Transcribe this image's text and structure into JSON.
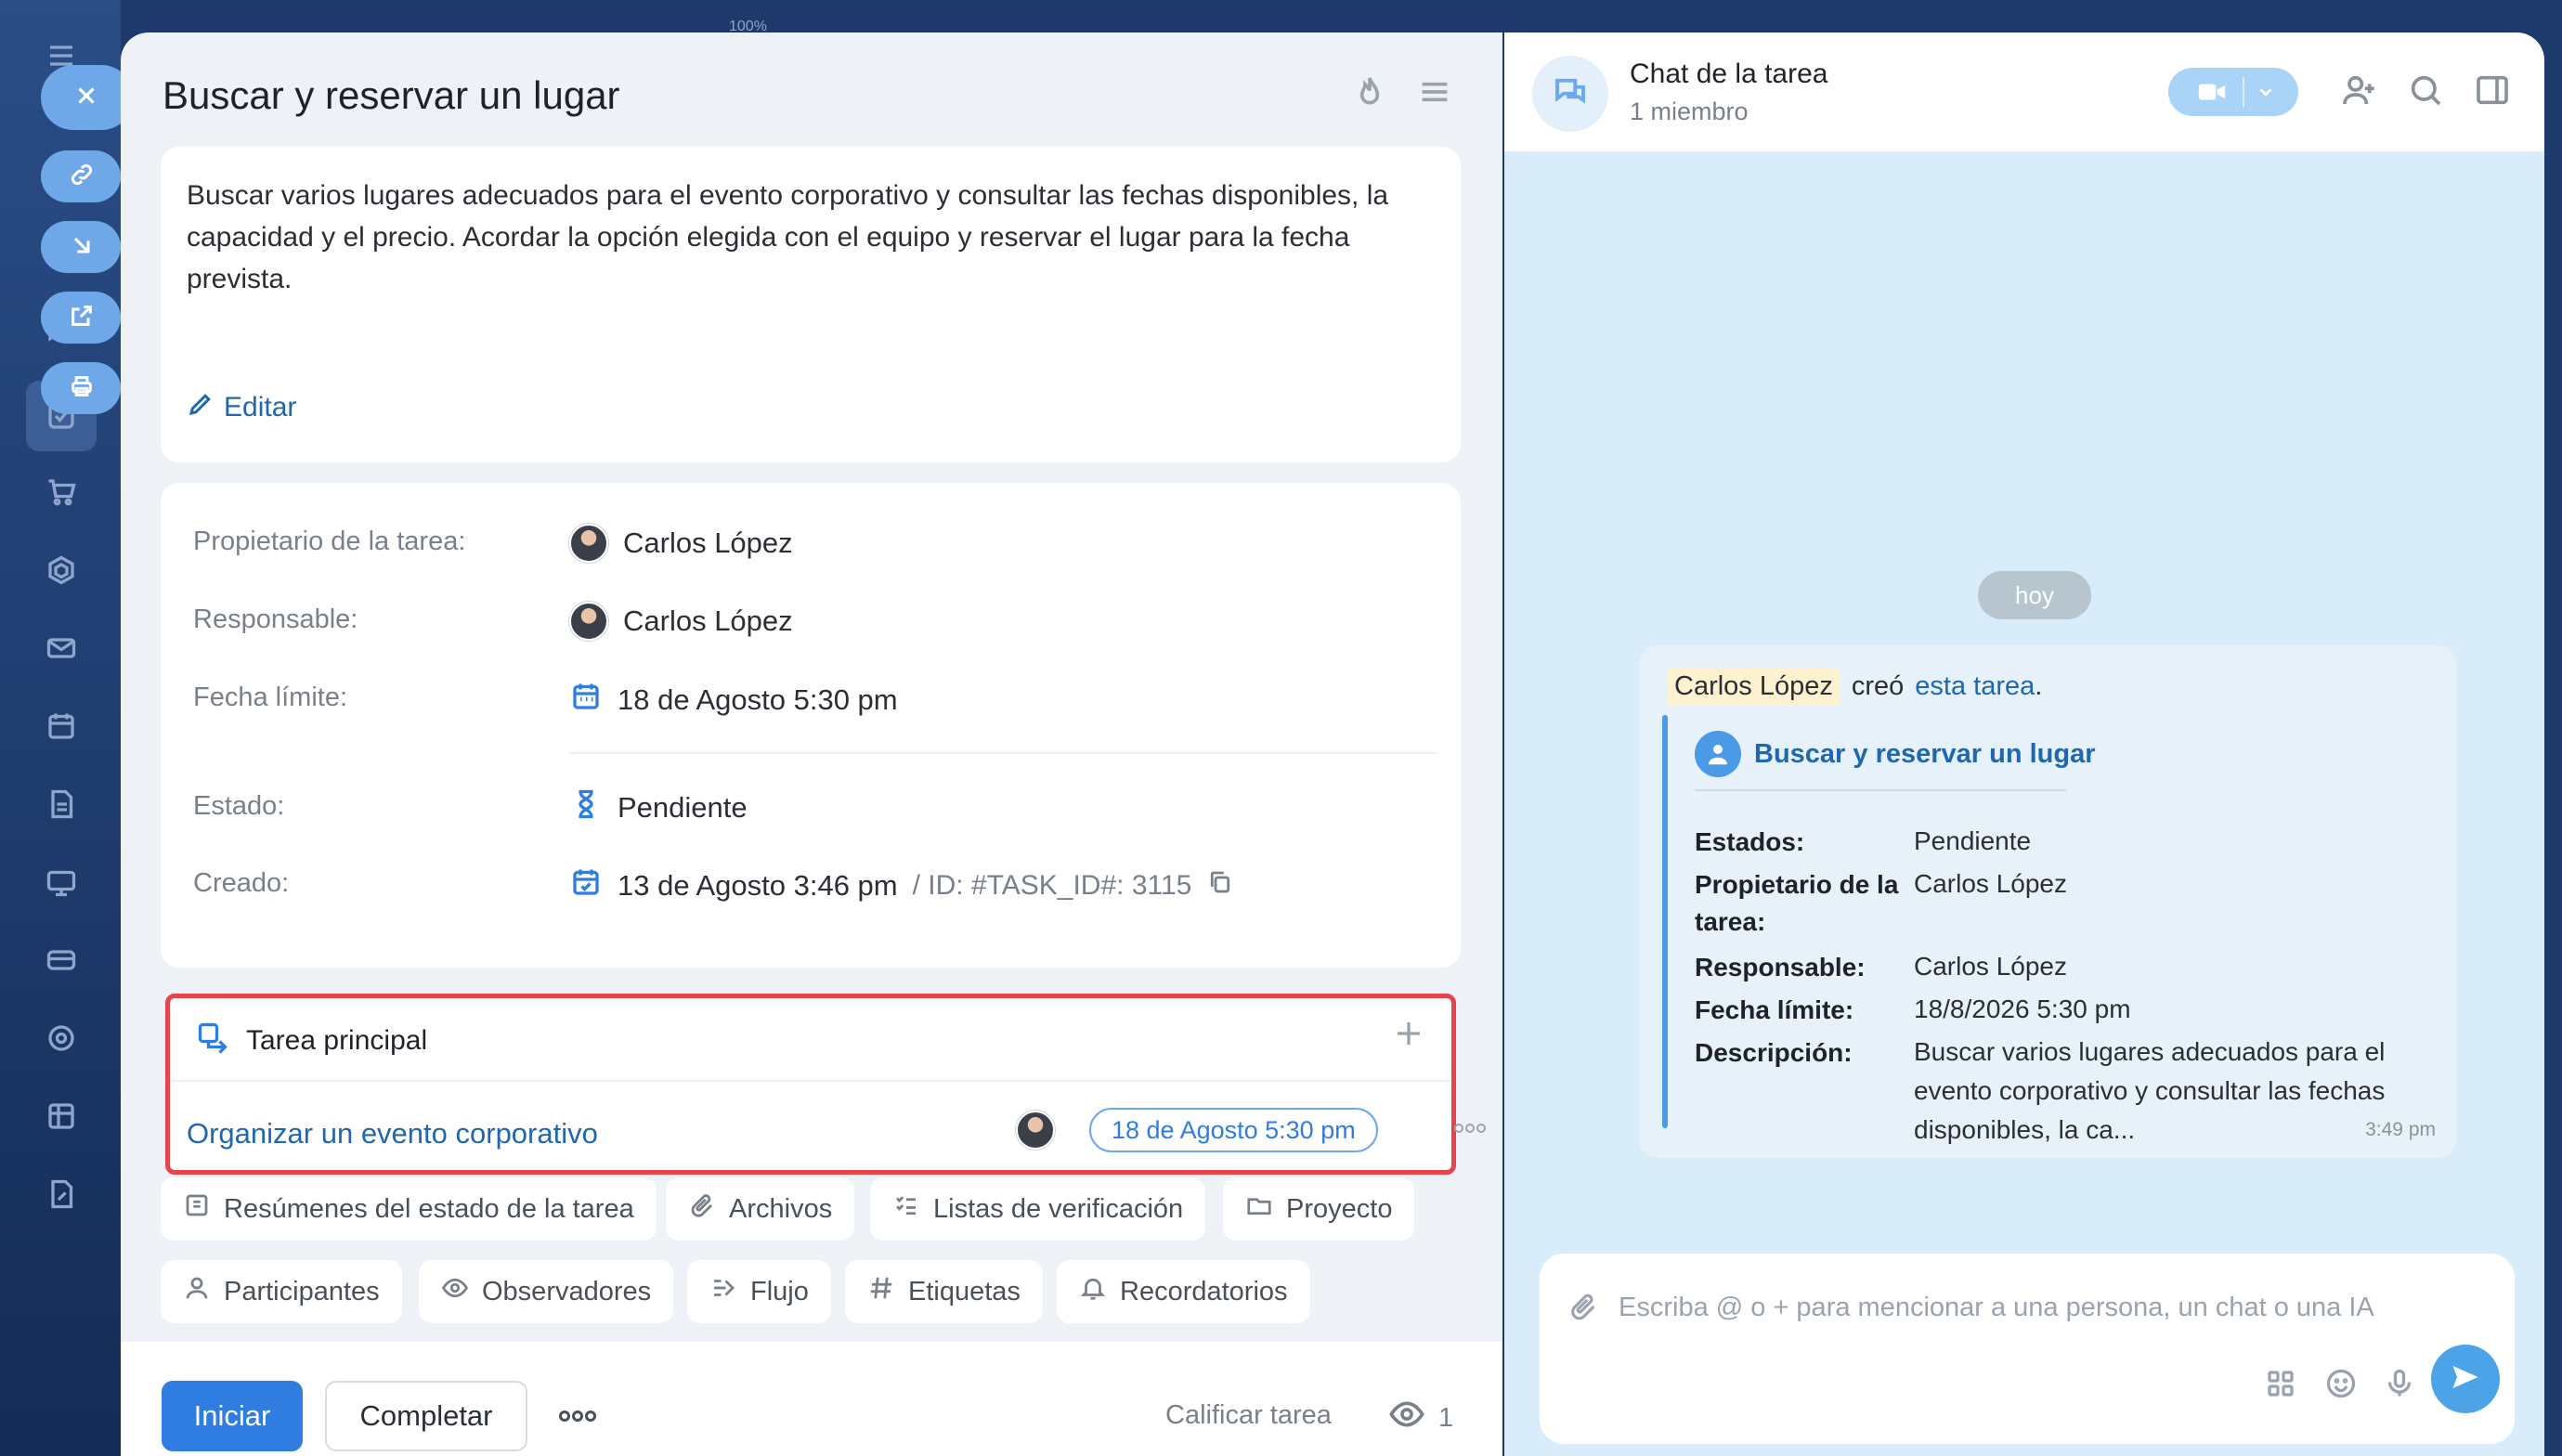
{
  "sidebar": {
    "icons": [
      "menu-icon",
      "chat-icon",
      "feed-icon",
      "messages-icon",
      "tasks-icon",
      "cart-icon",
      "hexagon-icon",
      "mail-icon",
      "calendar-icon",
      "document-icon",
      "board-icon",
      "card-icon",
      "target-icon",
      "grid-icon",
      "file-edit-icon"
    ],
    "float_buttons": [
      "close-icon",
      "link-icon",
      "download-icon",
      "open-external-icon",
      "print-icon"
    ]
  },
  "zoom": "100%",
  "task": {
    "title": "Buscar y reservar un lugar",
    "description": "Buscar varios lugares adecuados para el evento corporativo y consultar las fechas disponibles, la capacidad y el precio. Acordar la opción elegida con el equipo y reservar el lugar para la fecha prevista.",
    "edit_label": "Editar",
    "fields": {
      "owner_label": "Propietario de la tarea:",
      "owner_value": "Carlos López",
      "responsible_label": "Responsable:",
      "responsible_value": "Carlos López",
      "deadline_label": "Fecha límite:",
      "deadline_value": "18 de Agosto 5:30 pm",
      "status_label": "Estado:",
      "status_value": "Pendiente",
      "created_label": "Creado:",
      "created_value": "13 de Agosto 3:46 pm",
      "id_text": "/  ID: #TASK_ID#: 3115"
    },
    "parent": {
      "header": "Tarea principal",
      "link": "Organizar un evento corporativo",
      "date": "18 de Agosto 5:30 pm"
    },
    "chips": [
      "Resúmenes del estado de la tarea",
      "Archivos",
      "Listas de verificación",
      "Proyecto",
      "Participantes",
      "Observadores",
      "Flujo",
      "Etiquetas",
      "Recordatorios"
    ],
    "footer": {
      "start": "Iniciar",
      "complete": "Completar",
      "rate": "Calificar tarea",
      "viewers": "1"
    }
  },
  "chat": {
    "title": "Chat de la tarea",
    "subtitle": "1 miembro",
    "day": "hoy",
    "message": {
      "author": "Carlos López",
      "verb": "creó",
      "link": "esta tarea",
      "suffix": ".",
      "quote_title": "Buscar y reservar un lugar",
      "rows": [
        {
          "label": "Estados:",
          "value": "Pendiente"
        },
        {
          "label": "Propietario de la tarea:",
          "value": "Carlos López"
        },
        {
          "label": "Responsable:",
          "value": "Carlos López"
        },
        {
          "label": "Fecha límite:",
          "value": "18/8/2026 5:30 pm"
        },
        {
          "label": "Descripción:",
          "value": "Buscar varios lugares adecuados para el evento corporativo y consultar las fechas disponibles, la ca..."
        }
      ],
      "time": "3:49 pm"
    },
    "input_placeholder": "Escriba @ o + para mencionar a una persona, un chat o una IA"
  },
  "colors": {
    "accent": "#2f7de0",
    "link": "#2067b0",
    "highlight_border": "#e6434b",
    "sidebar": "#1d3a6b",
    "chat_bg": "#d8ecf9"
  }
}
